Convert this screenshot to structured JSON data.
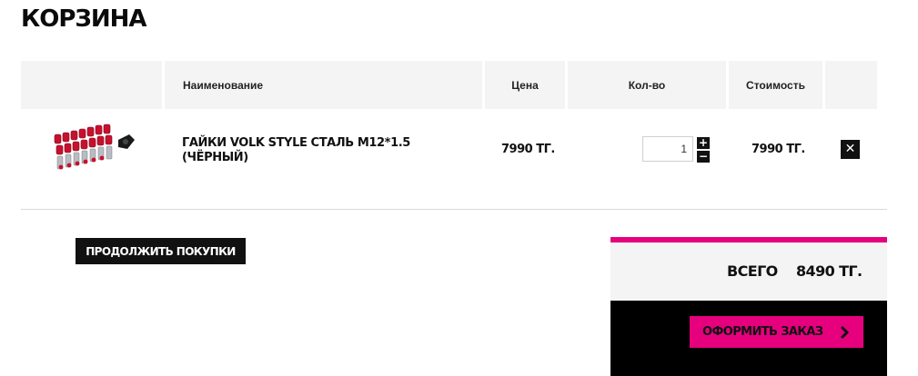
{
  "page": {
    "title": "КОРЗИНА"
  },
  "table": {
    "headers": {
      "name": "Наименование",
      "price": "Цена",
      "qty": "Кол-во",
      "cost": "Стоимость"
    }
  },
  "cart_item": {
    "image_alt": "Гайки Volk Style",
    "name": "ГАЙКИ VOLK STYLE СТАЛЬ M12*1.5 (ЧЁРНЫЙ)",
    "price": "7990 ТГ.",
    "quantity": "1",
    "cost": "7990 ТГ.",
    "qty_plus": "+",
    "qty_minus": "−",
    "remove": "✕"
  },
  "actions": {
    "continue_label": "ПРОДОЛЖИТЬ ПОКУПКИ",
    "checkout_label": "ОФОРМИТЬ ЗАКАЗ"
  },
  "summary": {
    "total_label": "ВСЕГО",
    "total_value": "8490 ТГ."
  },
  "colors": {
    "accent": "#e6007e",
    "dark": "#000000",
    "header_bg": "#f4f4f4"
  },
  "icons": {
    "remove": "close-icon",
    "checkout": "chevron-right-icon",
    "plus": "plus-icon",
    "minus": "minus-icon"
  }
}
